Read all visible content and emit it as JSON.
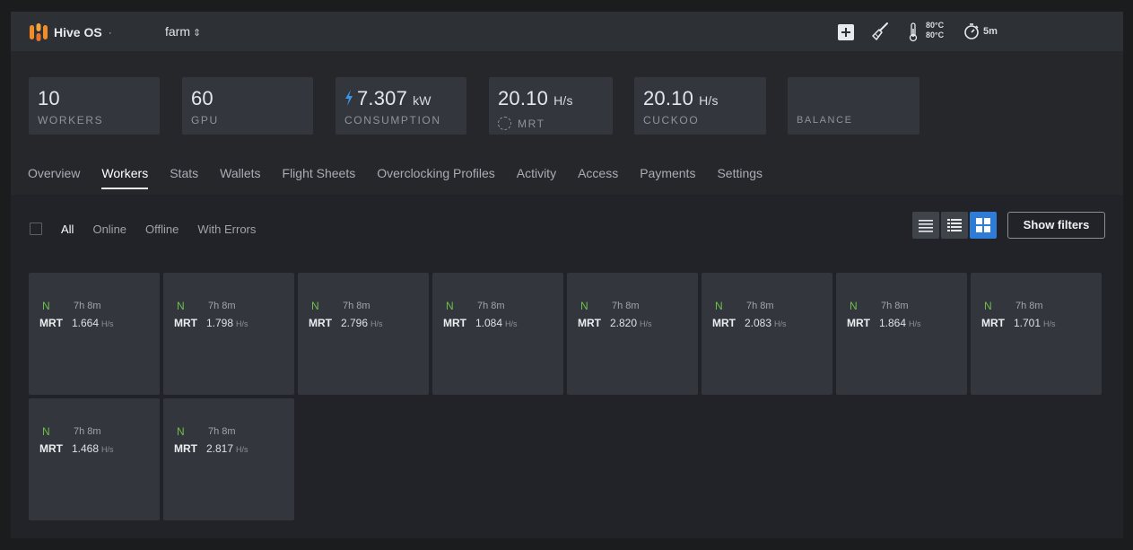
{
  "app": {
    "name": "Hive OS",
    "dot": "·"
  },
  "farm": {
    "name": "farm",
    "caret": "⇕"
  },
  "topbar": {
    "temp_high": "80°C",
    "temp_low": "80°C",
    "timer": "5m"
  },
  "stats": [
    {
      "value": "10",
      "unit": "",
      "label": "WORKERS"
    },
    {
      "value": "60",
      "unit": "",
      "label": "GPU"
    },
    {
      "value": "7.307",
      "unit": "kW",
      "label": "CONSUMPTION"
    },
    {
      "value": "20.10",
      "unit": "H/s",
      "label": "MRT"
    },
    {
      "value": "20.10",
      "unit": "H/s",
      "label": "CUCKOO"
    },
    {
      "value": "",
      "unit": "",
      "label": "BALANCE"
    }
  ],
  "tabs": [
    "Overview",
    "Workers",
    "Stats",
    "Wallets",
    "Flight Sheets",
    "Overclocking Profiles",
    "Activity",
    "Access",
    "Payments",
    "Settings"
  ],
  "active_tab": "Workers",
  "filters": [
    "All",
    "Online",
    "Offline",
    "With Errors"
  ],
  "active_filter": "All",
  "show_filters_label": "Show filters",
  "workers": [
    {
      "status": "N",
      "uptime": "7h 8m",
      "algo": "MRT",
      "rate": "1.664",
      "unit": "H/s"
    },
    {
      "status": "N",
      "uptime": "7h 8m",
      "algo": "MRT",
      "rate": "1.798",
      "unit": "H/s"
    },
    {
      "status": "N",
      "uptime": "7h 8m",
      "algo": "MRT",
      "rate": "2.796",
      "unit": "H/s"
    },
    {
      "status": "N",
      "uptime": "7h 8m",
      "algo": "MRT",
      "rate": "1.084",
      "unit": "H/s"
    },
    {
      "status": "N",
      "uptime": "7h 8m",
      "algo": "MRT",
      "rate": "2.820",
      "unit": "H/s"
    },
    {
      "status": "N",
      "uptime": "7h 8m",
      "algo": "MRT",
      "rate": "2.083",
      "unit": "H/s"
    },
    {
      "status": "N",
      "uptime": "7h 8m",
      "algo": "MRT",
      "rate": "1.864",
      "unit": "H/s"
    },
    {
      "status": "N",
      "uptime": "7h 8m",
      "algo": "MRT",
      "rate": "1.701",
      "unit": "H/s"
    },
    {
      "status": "N",
      "uptime": "7h 8m",
      "algo": "MRT",
      "rate": "1.468",
      "unit": "H/s"
    },
    {
      "status": "N",
      "uptime": "7h 8m",
      "algo": "MRT",
      "rate": "2.817",
      "unit": "H/s"
    }
  ],
  "colors": {
    "accent": "#2f7cd6",
    "online": "#6dbf4c",
    "logo_orange": "#f28c28"
  }
}
